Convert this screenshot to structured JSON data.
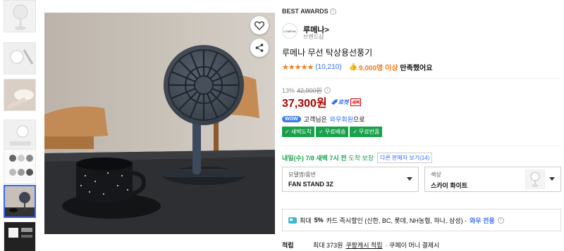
{
  "awards": {
    "label": "BEST AWARDS",
    "info": "i"
  },
  "brand": {
    "logo_text": "LUMENA",
    "name": "루메나",
    "chevron": ">",
    "sub": "브랜드샵"
  },
  "product": {
    "title": "루메나 무선 탁상용선풍기",
    "rating_stars": "★★★★★",
    "review_count": "(10,210)",
    "satisfied_count": "9,000명 이상",
    "satisfied_text": "만족했어요"
  },
  "pricing": {
    "discount": "13%",
    "original_price": "42,900원",
    "price": "37,300원",
    "rocket_label": "로켓",
    "rocket_new": "새벽"
  },
  "wow": {
    "badge": "WOW",
    "text_before": "고객님은",
    "link": "와우회원",
    "text_after": "으로",
    "benefits": [
      "새벽도착",
      "무료배송",
      "무료반품"
    ]
  },
  "delivery": {
    "date": "내일(수) 7/8 새벽 7시 전",
    "guarantee": "도착 보장",
    "other_sellers": "다른 판매자 보기(14)"
  },
  "options": {
    "model": {
      "label": "모델명/품번",
      "value": "FAN STAND 3Z"
    },
    "color": {
      "label": "색상",
      "value": "스카이 화이트"
    }
  },
  "card_promo": {
    "prefix": "최대",
    "pct": "5%",
    "text": "카드 즉시할인 (신한, BC, 롯데, NH농협, 하나, 삼성) -",
    "wow_only": "와우 전용",
    "info": "i"
  },
  "reward": {
    "label": "적립",
    "text_prefix": "최대 373원",
    "link": "쿠팡캐시 적립",
    "text_suffix": "· 쿠페이 머니 결제시"
  },
  "colors": {
    "accent": "#346aff",
    "price": "#ae0000",
    "green": "#1aa14c",
    "star": "#f37b1d"
  }
}
